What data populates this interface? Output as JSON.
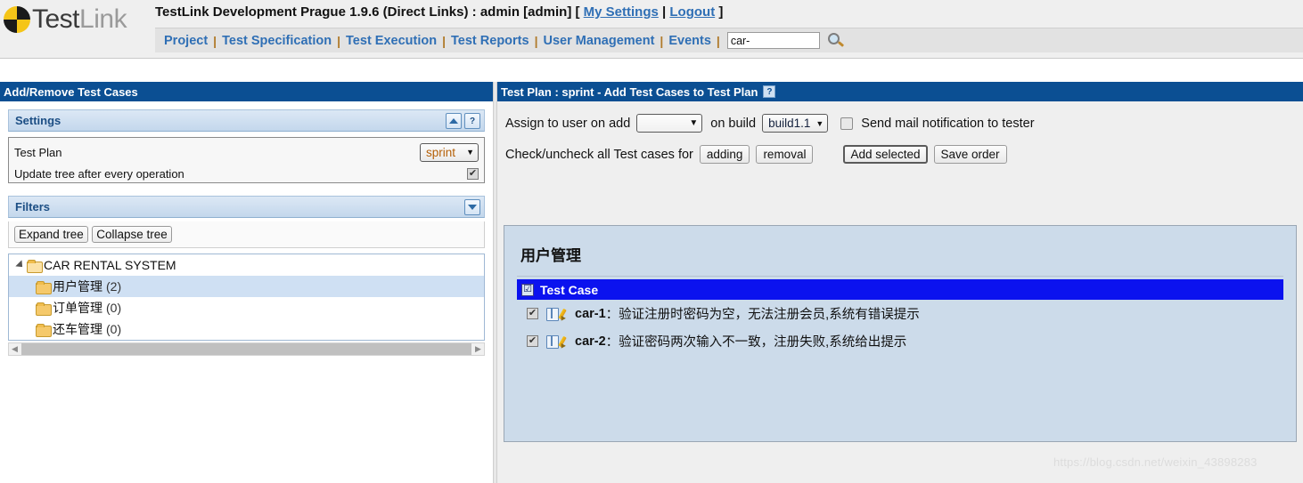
{
  "header": {
    "logo": {
      "part1": "Test",
      "part2": "Link",
      "icon": "testlink-logo-icon"
    },
    "title_text": "TestLink Development Prague 1.9.6 (Direct Links) : admin [admin] [",
    "my_settings": "My Settings",
    "title_sep": "|",
    "logout": "Logout",
    "title_end": "]"
  },
  "nav": {
    "items": [
      {
        "label": "Project"
      },
      {
        "label": "Test Specification"
      },
      {
        "label": "Test Execution"
      },
      {
        "label": "Test Reports"
      },
      {
        "label": "User Management"
      },
      {
        "label": "Events"
      }
    ],
    "separator": "|",
    "search": {
      "value": "car-",
      "placeholder": "",
      "icon": "search-icon"
    }
  },
  "left_panel": {
    "title": "Add/Remove Test Cases",
    "settings": {
      "heading": "Settings",
      "collapse_icon": "chevron-up-icon",
      "help_label": "?",
      "test_plan_label": "Test Plan",
      "test_plan_value": "sprint",
      "caret": "▼",
      "update_tree_label": "Update tree after every operation",
      "update_tree_checked": "✔"
    },
    "filters": {
      "heading": "Filters",
      "expand_icon": "chevron-down-icon",
      "expand_tree_label": "Expand tree",
      "collapse_tree_label": "Collapse tree"
    },
    "tree": [
      {
        "label": "CAR RENTAL SYSTEM",
        "count": "",
        "level": 0,
        "selected": false,
        "folder": "folder-open-icon"
      },
      {
        "label": "用户管理",
        "count": "(2)",
        "level": 1,
        "selected": true,
        "folder": "folder-icon"
      },
      {
        "label": "订单管理",
        "count": "(0)",
        "level": 1,
        "selected": false,
        "folder": "folder-icon"
      },
      {
        "label": "还车管理",
        "count": "(0)",
        "level": 1,
        "selected": false,
        "folder": "folder-icon"
      }
    ],
    "scroll": {
      "left_arrow": "◀",
      "right_arrow": "▶"
    }
  },
  "right_panel": {
    "title": "Test Plan : sprint - Add Test Cases to Test Plan",
    "help_label": "?",
    "assign_label": "Assign to user on add",
    "assign_value": "",
    "assign_caret": "▼",
    "on_build_label": "on build",
    "build_value": "build1.1",
    "build_caret": "▼",
    "send_mail_label": "Send mail notification to tester",
    "send_mail_checked": false,
    "check_uncheck_label": "Check/uncheck all Test cases for",
    "adding_button": "adding",
    "removal_button": "removal",
    "add_selected_button": "Add selected",
    "save_order_button": "Save order",
    "test_cases": {
      "group_title": "用户管理",
      "header_label": "Test Case",
      "header_checked": "☑",
      "rows": [
        {
          "checked": "✔",
          "id": "car-1",
          "sep": "：",
          "title": "验证注册时密码为空，无法注册会员,系统有错误提示",
          "doc_icon": "document-icon",
          "edit_icon": "pencil-icon"
        },
        {
          "checked": "✔",
          "id": "car-2",
          "sep": "：",
          "title": "验证密码两次输入不一致，注册失败,系统给出提示",
          "doc_icon": "document-icon",
          "edit_icon": "pencil-icon"
        }
      ]
    }
  },
  "watermark": "https://blog.csdn.net/weixin_43898283",
  "colors": {
    "title_bar": "#0b4f93",
    "link": "#2f6fb5",
    "accent_orange": "#b45f06",
    "tc_header_blue": "#0b12ef",
    "tc_panel_bg": "#ccdbea"
  }
}
